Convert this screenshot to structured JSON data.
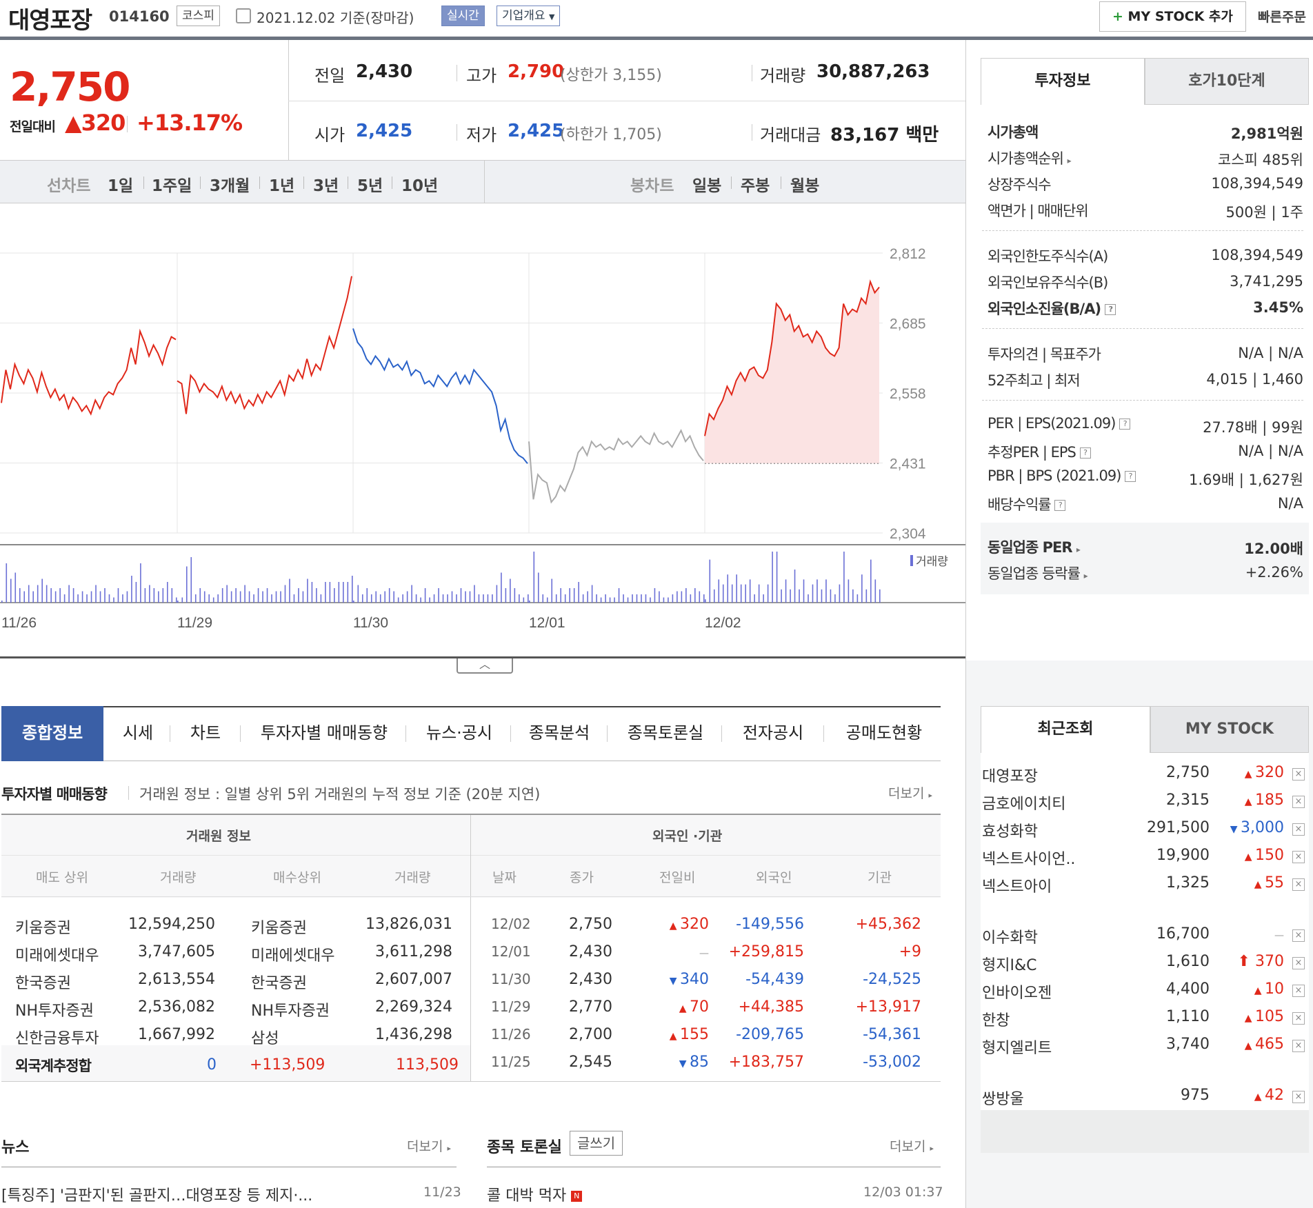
{
  "header": {
    "stock_name": "대영포장",
    "stock_code": "014160",
    "market_tag": "코스피",
    "date_text": "2021.12.02 기준(장마감)",
    "realtime_tag": "실시간",
    "corp_tag": "기업개요",
    "mystock_add": "MY STOCK 추가",
    "quick_order": "빠른주문"
  },
  "price": {
    "current": "2,750",
    "change_label": "전일대비",
    "change_abs": "320",
    "change_pct": "+13.17%",
    "prev_label": "전일",
    "prev": "2,430",
    "open_label": "시가",
    "open": "2,425",
    "high_label": "고가",
    "high": "2,790",
    "high_sub": "(상한가 3,155)",
    "low_label": "저가",
    "low": "2,425",
    "low_sub": "(하한가 1,705)",
    "volume_label": "거래량",
    "volume": "30,887,263",
    "amount_label": "거래대금",
    "amount": "83,167 백만"
  },
  "period_bar": {
    "line_label": "선차트",
    "line_periods": [
      "1일",
      "1주일",
      "3개월",
      "1년",
      "3년",
      "5년",
      "10년"
    ],
    "selected": "1주일",
    "candle_label": "봉차트",
    "candle_periods": [
      "일봉",
      "주봉",
      "월봉"
    ]
  },
  "chart_data": {
    "type": "line",
    "x_labels": [
      "11/26",
      "11/29",
      "11/30",
      "12/01",
      "12/02"
    ],
    "y_ticks": [
      2812,
      2685,
      2558,
      2431,
      2304
    ],
    "ylim": [
      2304,
      2812
    ],
    "reference_price": 2430,
    "volume_label": "거래량",
    "colors": {
      "up": "#e0281a",
      "down": "#2a62c9",
      "flat": "#aaaaaa",
      "fill": "#fbe3e3"
    },
    "segments": [
      {
        "day": "11/26",
        "color": "up",
        "values": [
          2540,
          2600,
          2565,
          2610,
          2590,
          2575,
          2600,
          2585,
          2560,
          2595,
          2570,
          2550,
          2565,
          2545,
          2555,
          2530,
          2550,
          2540,
          2525,
          2535,
          2520,
          2545,
          2530,
          2550,
          2560,
          2555,
          2575,
          2585,
          2600,
          2640,
          2610,
          2670,
          2650,
          2625,
          2645,
          2630,
          2610,
          2640,
          2660,
          2655
        ]
      },
      {
        "day": "11/29",
        "color": "up",
        "values": [
          2580,
          2575,
          2520,
          2590,
          2580,
          2560,
          2575,
          2565,
          2560,
          2550,
          2570,
          2545,
          2560,
          2540,
          2555,
          2530,
          2545,
          2535,
          2555,
          2540,
          2560,
          2550,
          2565,
          2580,
          2555,
          2590,
          2580,
          2600,
          2585,
          2620,
          2590,
          2610,
          2600,
          2630,
          2660,
          2640,
          2670,
          2700,
          2730,
          2770
        ]
      },
      {
        "day": "11/30",
        "color": "down",
        "values": [
          2675,
          2650,
          2640,
          2620,
          2610,
          2625,
          2615,
          2600,
          2620,
          2605,
          2610,
          2600,
          2615,
          2590,
          2600,
          2595,
          2575,
          2580,
          2570,
          2590,
          2580,
          2570,
          2585,
          2595,
          2575,
          2590,
          2575,
          2600,
          2590,
          2580,
          2570,
          2560,
          2535,
          2490,
          2510,
          2475,
          2455,
          2445,
          2440,
          2430
        ]
      },
      {
        "day": "12/01",
        "color": "flat",
        "values": [
          2470,
          2365,
          2410,
          2400,
          2395,
          2360,
          2370,
          2390,
          2380,
          2400,
          2420,
          2450,
          2460,
          2445,
          2470,
          2460,
          2465,
          2455,
          2460,
          2455,
          2475,
          2465,
          2470,
          2460,
          2470,
          2480,
          2470,
          2465,
          2485,
          2470,
          2465,
          2470,
          2460,
          2475,
          2490,
          2470,
          2480,
          2460,
          2445,
          2435
        ]
      },
      {
        "day": "12/02",
        "color": "up",
        "values": [
          2480,
          2520,
          2510,
          2530,
          2545,
          2570,
          2555,
          2580,
          2595,
          2580,
          2600,
          2605,
          2590,
          2585,
          2600,
          2650,
          2720,
          2710,
          2690,
          2700,
          2670,
          2680,
          2660,
          2665,
          2650,
          2670,
          2660,
          2640,
          2630,
          2625,
          2640,
          2720,
          2700,
          2710,
          2705,
          2730,
          2720,
          2760,
          2740,
          2750
        ]
      }
    ]
  },
  "right_panel": {
    "tabs": [
      "투자정보",
      "호가10단계"
    ],
    "rows_a": [
      {
        "label": "시가총액",
        "value": "2,981억원",
        "bold": true
      },
      {
        "label": "시가총액순위",
        "value": "코스피 485위"
      },
      {
        "label": "상장주식수",
        "value": "108,394,549"
      },
      {
        "label": "액면가 | 매매단위",
        "value": "500원 | 1주"
      }
    ],
    "rows_b": [
      {
        "label": "외국인한도주식수(A)",
        "value": "108,394,549"
      },
      {
        "label": "외국인보유주식수(B)",
        "value": "3,741,295"
      },
      {
        "label": "외국인소진율(B/A)",
        "value": "3.45%",
        "bold": true
      }
    ],
    "rows_c": [
      {
        "label": "투자의견 | 목표주가",
        "value": "N/A | N/A"
      },
      {
        "label": "52주최고 | 최저",
        "value": "4,015 | 1,460"
      }
    ],
    "rows_d": [
      {
        "label": "PER | EPS(2021.09)",
        "value": "27.78배 | 99원"
      },
      {
        "label": "추정PER | EPS",
        "value": "N/A | N/A"
      },
      {
        "label": "PBR | BPS (2021.09)",
        "value": "1.69배 | 1,627원"
      },
      {
        "label": "배당수익률",
        "value": "N/A"
      }
    ],
    "rows_e": [
      {
        "label": "동일업종 PER",
        "value": "12.00배",
        "bold": true
      },
      {
        "label": "동일업종 등락률",
        "value": "+2.26%"
      }
    ],
    "recent_tabs": [
      "최근조회",
      "MY STOCK"
    ],
    "recent": [
      {
        "name": "대영포장",
        "price": "2,750",
        "change": "320",
        "dir": "up"
      },
      {
        "name": "금호에이치티",
        "price": "2,315",
        "change": "185",
        "dir": "up"
      },
      {
        "name": "효성화학",
        "price": "291,500",
        "change": "3,000",
        "dir": "down"
      },
      {
        "name": "넥스트사이언..",
        "price": "19,900",
        "change": "150",
        "dir": "up"
      },
      {
        "name": "넥스트아이",
        "price": "1,325",
        "change": "55",
        "dir": "up"
      },
      {
        "name": "이수화학",
        "price": "16,700",
        "change": "",
        "dir": "flat"
      },
      {
        "name": "형지I&C",
        "price": "1,610",
        "change": "370",
        "dir": "upper"
      },
      {
        "name": "인바이오젠",
        "price": "4,400",
        "change": "10",
        "dir": "up"
      },
      {
        "name": "한창",
        "price": "1,110",
        "change": "105",
        "dir": "up"
      },
      {
        "name": "형지엘리트",
        "price": "3,740",
        "change": "465",
        "dir": "up"
      },
      {
        "name": "쌍방울",
        "price": "975",
        "change": "42",
        "dir": "up"
      }
    ]
  },
  "tabs": [
    "종합정보",
    "시세",
    "차트",
    "투자자별 매매동향",
    "뉴스·공시",
    "종목분석",
    "종목토론실",
    "전자공시",
    "공매도현황"
  ],
  "investor": {
    "title": "투자자별 매매동향",
    "desc": "거래원 정보 : 일별 상위 5위 거래원의 누적 정보 기준 (20분 지연)",
    "more": "더보기",
    "broker_header": "거래원 정보",
    "foreign_header": "외국인 ·기관",
    "broker_cols": [
      "매도 상위",
      "거래량",
      "매수상위",
      "거래량"
    ],
    "foreign_cols": [
      "날짜",
      "종가",
      "전일비",
      "외국인",
      "기관"
    ],
    "brokers": [
      {
        "sell": "키움증권",
        "sell_vol": "12,594,250",
        "buy": "키움증권",
        "buy_vol": "13,826,031"
      },
      {
        "sell": "미래에셋대우",
        "sell_vol": "3,747,605",
        "buy": "미래에셋대우",
        "buy_vol": "3,611,298"
      },
      {
        "sell": "한국증권",
        "sell_vol": "2,613,554",
        "buy": "한국증권",
        "buy_vol": "2,607,007"
      },
      {
        "sell": "NH투자증권",
        "sell_vol": "2,536,082",
        "buy": "NH투자증권",
        "buy_vol": "2,269,324"
      },
      {
        "sell": "신한금융투자",
        "sell_vol": "1,667,992",
        "buy": "삼성",
        "buy_vol": "1,436,298"
      }
    ],
    "foreign_total_label": "외국계추정합",
    "foreign_total": {
      "sell": "0",
      "net": "+113,509",
      "buy": "113,509"
    },
    "foreign_rows": [
      {
        "date": "12/02",
        "close": "2,750",
        "diff": "320",
        "dir": "up",
        "foreign": "-149,556",
        "inst": "+45,362"
      },
      {
        "date": "12/01",
        "close": "2,430",
        "diff": "",
        "dir": "flat",
        "foreign": "+259,815",
        "inst": "+9"
      },
      {
        "date": "11/30",
        "close": "2,430",
        "diff": "340",
        "dir": "down",
        "foreign": "-54,439",
        "inst": "-24,525"
      },
      {
        "date": "11/29",
        "close": "2,770",
        "diff": "70",
        "dir": "up",
        "foreign": "+44,385",
        "inst": "+13,917"
      },
      {
        "date": "11/26",
        "close": "2,700",
        "diff": "155",
        "dir": "up",
        "foreign": "-209,765",
        "inst": "-54,361"
      },
      {
        "date": "11/25",
        "close": "2,545",
        "diff": "85",
        "dir": "down",
        "foreign": "+183,757",
        "inst": "-53,002"
      }
    ]
  },
  "news": {
    "title": "뉴스",
    "more": "더보기",
    "item": "[특징주] '금판지'된 골판지…대영포장 등 제지·...",
    "item_date": "11/23"
  },
  "discussion": {
    "title": "종목 토론실",
    "write": "글쓰기",
    "more": "더보기",
    "item": "콜 대박 먹자",
    "item_date": "12/03 01:37"
  }
}
